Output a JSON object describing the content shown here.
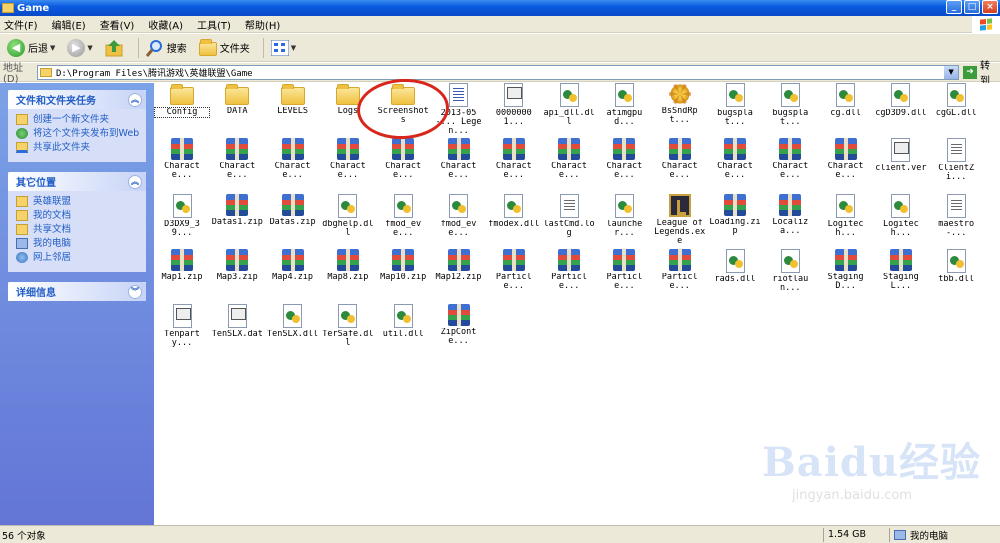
{
  "window": {
    "title": "Game"
  },
  "menu": [
    "文件(F)",
    "编辑(E)",
    "查看(V)",
    "收藏(A)",
    "工具(T)",
    "帮助(H)"
  ],
  "toolbar": {
    "back": "后退",
    "search": "搜索",
    "folders": "文件夹"
  },
  "address": {
    "label": "地址(D)",
    "path": "D:\\Program Files\\腾讯游戏\\英雄联盟\\Game",
    "go": "转到"
  },
  "left": {
    "tasks": {
      "title": "文件和文件夹任务",
      "items": [
        "创建一个新文件夹",
        "将这个文件夹发布到Web",
        "共享此文件夹"
      ]
    },
    "places": {
      "title": "其它位置",
      "items": [
        "英雄联盟",
        "我的文档",
        "共享文档",
        "我的电脑",
        "网上邻居"
      ]
    },
    "details": {
      "title": "详细信息"
    }
  },
  "files": [
    {
      "name": "Config",
      "type": "folder"
    },
    {
      "name": "DATA",
      "type": "folder"
    },
    {
      "name": "LEVELS",
      "type": "folder"
    },
    {
      "name": "Logs",
      "type": "folder"
    },
    {
      "name": "Screenshots",
      "type": "folder"
    },
    {
      "name": "2013-05-... Legen...",
      "type": "doc"
    },
    {
      "name": "00000001...",
      "type": "gen"
    },
    {
      "name": "api_dll.dll",
      "type": "dll"
    },
    {
      "name": "atimgpud...",
      "type": "dll"
    },
    {
      "name": "BsSndRpt...",
      "type": "bug"
    },
    {
      "name": "bugsplat...",
      "type": "dll"
    },
    {
      "name": "bugsplat...",
      "type": "dll"
    },
    {
      "name": "cg.dll",
      "type": "dll"
    },
    {
      "name": "cgD3D9.dll",
      "type": "dll"
    },
    {
      "name": "cgGL.dll",
      "type": "dll"
    },
    {
      "name": "Characte...",
      "type": "zip"
    },
    {
      "name": "Characte...",
      "type": "zip"
    },
    {
      "name": "Characte...",
      "type": "zip"
    },
    {
      "name": "Characte...",
      "type": "zip"
    },
    {
      "name": "Characte...",
      "type": "zip"
    },
    {
      "name": "Characte...",
      "type": "zip"
    },
    {
      "name": "Characte...",
      "type": "zip"
    },
    {
      "name": "Characte...",
      "type": "zip"
    },
    {
      "name": "Characte...",
      "type": "zip"
    },
    {
      "name": "Characte...",
      "type": "zip"
    },
    {
      "name": "Characte...",
      "type": "zip"
    },
    {
      "name": "Characte...",
      "type": "zip"
    },
    {
      "name": "Characte...",
      "type": "zip"
    },
    {
      "name": "client.ver",
      "type": "gen"
    },
    {
      "name": "ClientZi...",
      "type": "txt"
    },
    {
      "name": "D3DX9_39...",
      "type": "dll"
    },
    {
      "name": "Datas1.zip",
      "type": "zip"
    },
    {
      "name": "Datas.zip",
      "type": "zip"
    },
    {
      "name": "dbghelp.dll",
      "type": "dll"
    },
    {
      "name": "fmod_eve...",
      "type": "dll"
    },
    {
      "name": "fmod_eve...",
      "type": "dll"
    },
    {
      "name": "fmodex.dll",
      "type": "dll"
    },
    {
      "name": "lastCmd.log",
      "type": "txt"
    },
    {
      "name": "launcher...",
      "type": "dll"
    },
    {
      "name": "League of Legends.exe",
      "type": "exe"
    },
    {
      "name": "Loading.zip",
      "type": "zip"
    },
    {
      "name": "Localiza...",
      "type": "zip"
    },
    {
      "name": "Logitech...",
      "type": "dll"
    },
    {
      "name": "Logitech...",
      "type": "dll"
    },
    {
      "name": "maestro-...",
      "type": "txt"
    },
    {
      "name": "Map1.zip",
      "type": "zip"
    },
    {
      "name": "Map3.zip",
      "type": "zip"
    },
    {
      "name": "Map4.zip",
      "type": "zip"
    },
    {
      "name": "Map8.zip",
      "type": "zip"
    },
    {
      "name": "Map10.zip",
      "type": "zip"
    },
    {
      "name": "Map12.zip",
      "type": "zip"
    },
    {
      "name": "Particle...",
      "type": "zip"
    },
    {
      "name": "Particle...",
      "type": "zip"
    },
    {
      "name": "Particle...",
      "type": "zip"
    },
    {
      "name": "Particle...",
      "type": "zip"
    },
    {
      "name": "rads.dll",
      "type": "dll"
    },
    {
      "name": "riotlaun...",
      "type": "dll"
    },
    {
      "name": "StagingD...",
      "type": "zip"
    },
    {
      "name": "StagingL...",
      "type": "zip"
    },
    {
      "name": "tbb.dll",
      "type": "dll"
    },
    {
      "name": "Tenparty...",
      "type": "gen"
    },
    {
      "name": "TenSLX.dat",
      "type": "gen"
    },
    {
      "name": "TenSLX.dll",
      "type": "dll"
    },
    {
      "name": "TerSafe.dll",
      "type": "dll"
    },
    {
      "name": "util.dll",
      "type": "dll"
    },
    {
      "name": "ZipConte...",
      "type": "zip"
    }
  ],
  "status": {
    "count": "56 个对象",
    "size": "1.54 GB",
    "location": "我的电脑"
  },
  "watermark": {
    "brand": "Baidu经验",
    "url": "jingyan.baidu.com"
  },
  "colors": {
    "title_blue": "#0a5be0",
    "task_blue": "#215dc6",
    "highlight_red": "#d8261c"
  }
}
